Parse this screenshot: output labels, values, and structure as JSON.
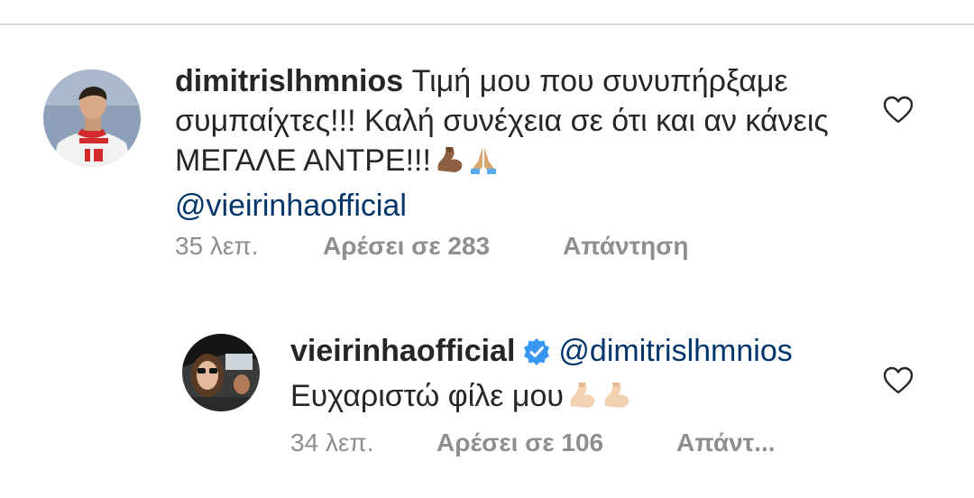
{
  "comments": [
    {
      "username": "dimitrislhmnios",
      "text": "Τιμή μου που συνυπήρξαμε συμπαίχτες!!! Καλή συνέχεια σε ότι και αν κάνεις ΜΕΓΑΛΕ ΑΝΤΡΕ!!!",
      "emojis": [
        "flexed-biceps",
        "folded-hands"
      ],
      "mention": "@vieirinhaofficial",
      "time": "35 λεπ.",
      "likes": "Αρέσει σε 283",
      "reply": "Απάντηση"
    },
    {
      "username": "vieirinhaofficial",
      "verified": true,
      "mention": "@dimitrislhmnios",
      "text": "Ευχαριστώ φίλε μου",
      "emojis": [
        "flexed-biceps",
        "flexed-biceps"
      ],
      "time": "34 λεπ.",
      "likes": "Αρέσει σε 106",
      "reply": "Απάντ..."
    }
  ],
  "colors": {
    "text": "#262626",
    "meta": "#8e8e8e",
    "mention": "#003569",
    "verified": "#3897f0"
  }
}
